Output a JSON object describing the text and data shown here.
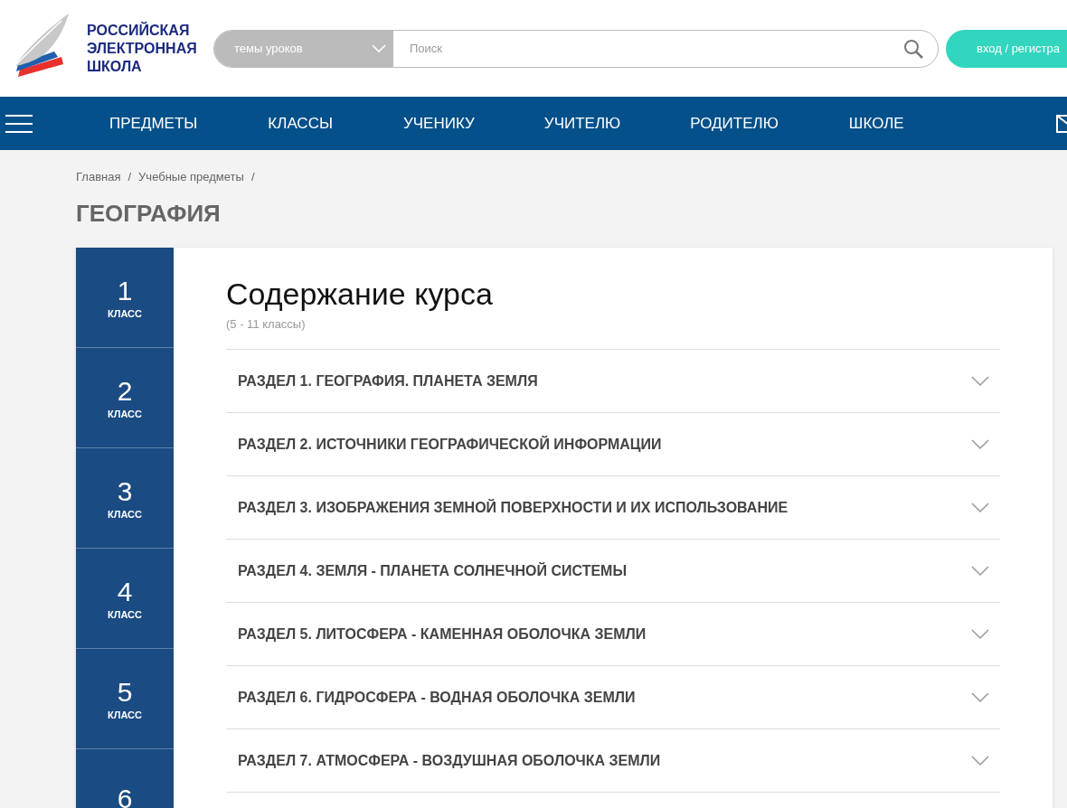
{
  "logo": {
    "lines": [
      "РОССИЙСКАЯ",
      "ЭЛЕКТРОННАЯ",
      "ШКОЛА"
    ]
  },
  "search": {
    "category": "темы уроков",
    "placeholder": "Поиск"
  },
  "login_button": "вход / регистра",
  "nav": [
    "ПРЕДМЕТЫ",
    "КЛАССЫ",
    "УЧЕНИКУ",
    "УЧИТЕЛЮ",
    "РОДИТЕЛЮ",
    "ШКОЛЕ"
  ],
  "breadcrumbs": [
    {
      "label": "Главная",
      "separator": "/"
    },
    {
      "label": "Учебные предметы",
      "separator": "/"
    }
  ],
  "page_title": "ГЕОГРАФИЯ",
  "grades": [
    {
      "number": "1",
      "label": "КЛАСС"
    },
    {
      "number": "2",
      "label": "КЛАСС"
    },
    {
      "number": "3",
      "label": "КЛАСС"
    },
    {
      "number": "4",
      "label": "КЛАСС"
    },
    {
      "number": "5",
      "label": "КЛАСС"
    },
    {
      "number": "6"
    }
  ],
  "content": {
    "title": "Содержание курса",
    "subtitle": "(5 - 11 классы)",
    "sections": [
      {
        "title": "РАЗДЕЛ 1. ГЕОГРАФИЯ. ПЛАНЕТА ЗЕМЛЯ",
        "expanded": false
      },
      {
        "title": "РАЗДЕЛ 2. ИСТОЧНИКИ ГЕОГРАФИЧЕСКОЙ ИНФОРМАЦИИ",
        "expanded": false
      },
      {
        "title": "РАЗДЕЛ 3. ИЗОБРАЖЕНИЯ ЗЕМНОЙ ПОВЕРХНОСТИ И ИХ ИСПОЛЬЗОВАНИЕ",
        "expanded": false
      },
      {
        "title": "РАЗДЕЛ 4. ЗЕМЛЯ - ПЛАНЕТА СОЛНЕЧНОЙ СИСТЕМЫ",
        "expanded": false
      },
      {
        "title": "РАЗДЕЛ 5. ЛИТОСФЕРА - КАМЕННАЯ ОБОЛОЧКА ЗЕМЛИ",
        "expanded": false
      },
      {
        "title": "РАЗДЕЛ 6. ГИДРОСФЕРА - ВОДНАЯ ОБОЛОЧКА ЗЕМЛИ",
        "expanded": false
      },
      {
        "title": "РАЗДЕЛ 7. АТМОСФЕРА - ВОЗДУШНАЯ ОБОЛОЧКА ЗЕМЛИ",
        "expanded": false
      }
    ]
  }
}
